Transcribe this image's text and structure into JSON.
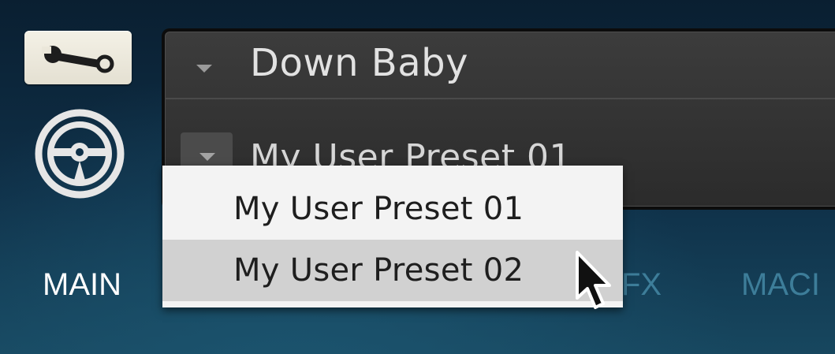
{
  "toolbar": {
    "settings_icon": "wrench-icon",
    "logo_icon": "native-instruments-logo"
  },
  "preset_panel": {
    "instrument_name": "Down Baby",
    "current_preset": "My User Preset 01"
  },
  "dropdown": {
    "options": [
      {
        "label": "My User Preset 01",
        "highlighted": false
      },
      {
        "label": "My User Preset 02",
        "highlighted": true
      }
    ]
  },
  "tabs": [
    {
      "label": "MAIN",
      "active": true
    },
    {
      "label": "FX",
      "active": false
    },
    {
      "label": "MACI",
      "active": false
    }
  ],
  "colors": {
    "background": "#0f3048",
    "panel": "#333333",
    "menu": "#f3f3f3",
    "menu_highlight": "#d1d1d1",
    "tab_inactive": "#3d7d99"
  }
}
